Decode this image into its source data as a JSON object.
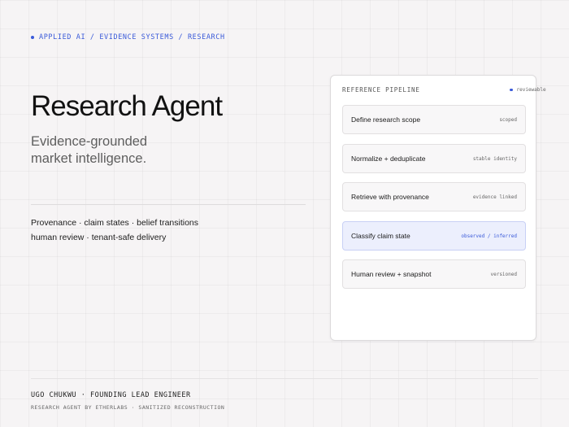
{
  "breadcrumb": "APPLIED AI / EVIDENCE SYSTEMS / RESEARCH",
  "hero": {
    "title": "Research Agent",
    "subtitle_lines": [
      "Evidence-grounded",
      "market intelligence."
    ]
  },
  "features": [
    "Provenance · claim states · belief transitions",
    "human review · tenant-safe delivery"
  ],
  "pipeline": {
    "title": "REFERENCE PIPELINE",
    "status": "reviewable",
    "steps": [
      {
        "label": "Define research scope",
        "tag": "scoped",
        "active": false
      },
      {
        "label": "Normalize + deduplicate",
        "tag": "stable identity",
        "active": false
      },
      {
        "label": "Retrieve with provenance",
        "tag": "evidence linked",
        "active": false
      },
      {
        "label": "Classify claim state",
        "tag": "observed / inferred",
        "active": true
      },
      {
        "label": "Human review + snapshot",
        "tag": "versioned",
        "active": false
      }
    ]
  },
  "footer": {
    "author": "UGO CHUKWU · FOUNDING LEAD ENGINEER",
    "credit": "RESEARCH AGENT BY ETHERLABS · SANITIZED RECONSTRUCTION"
  },
  "colors": {
    "accent": "#3a5ad9",
    "active_step_bg": "#eceffd"
  }
}
